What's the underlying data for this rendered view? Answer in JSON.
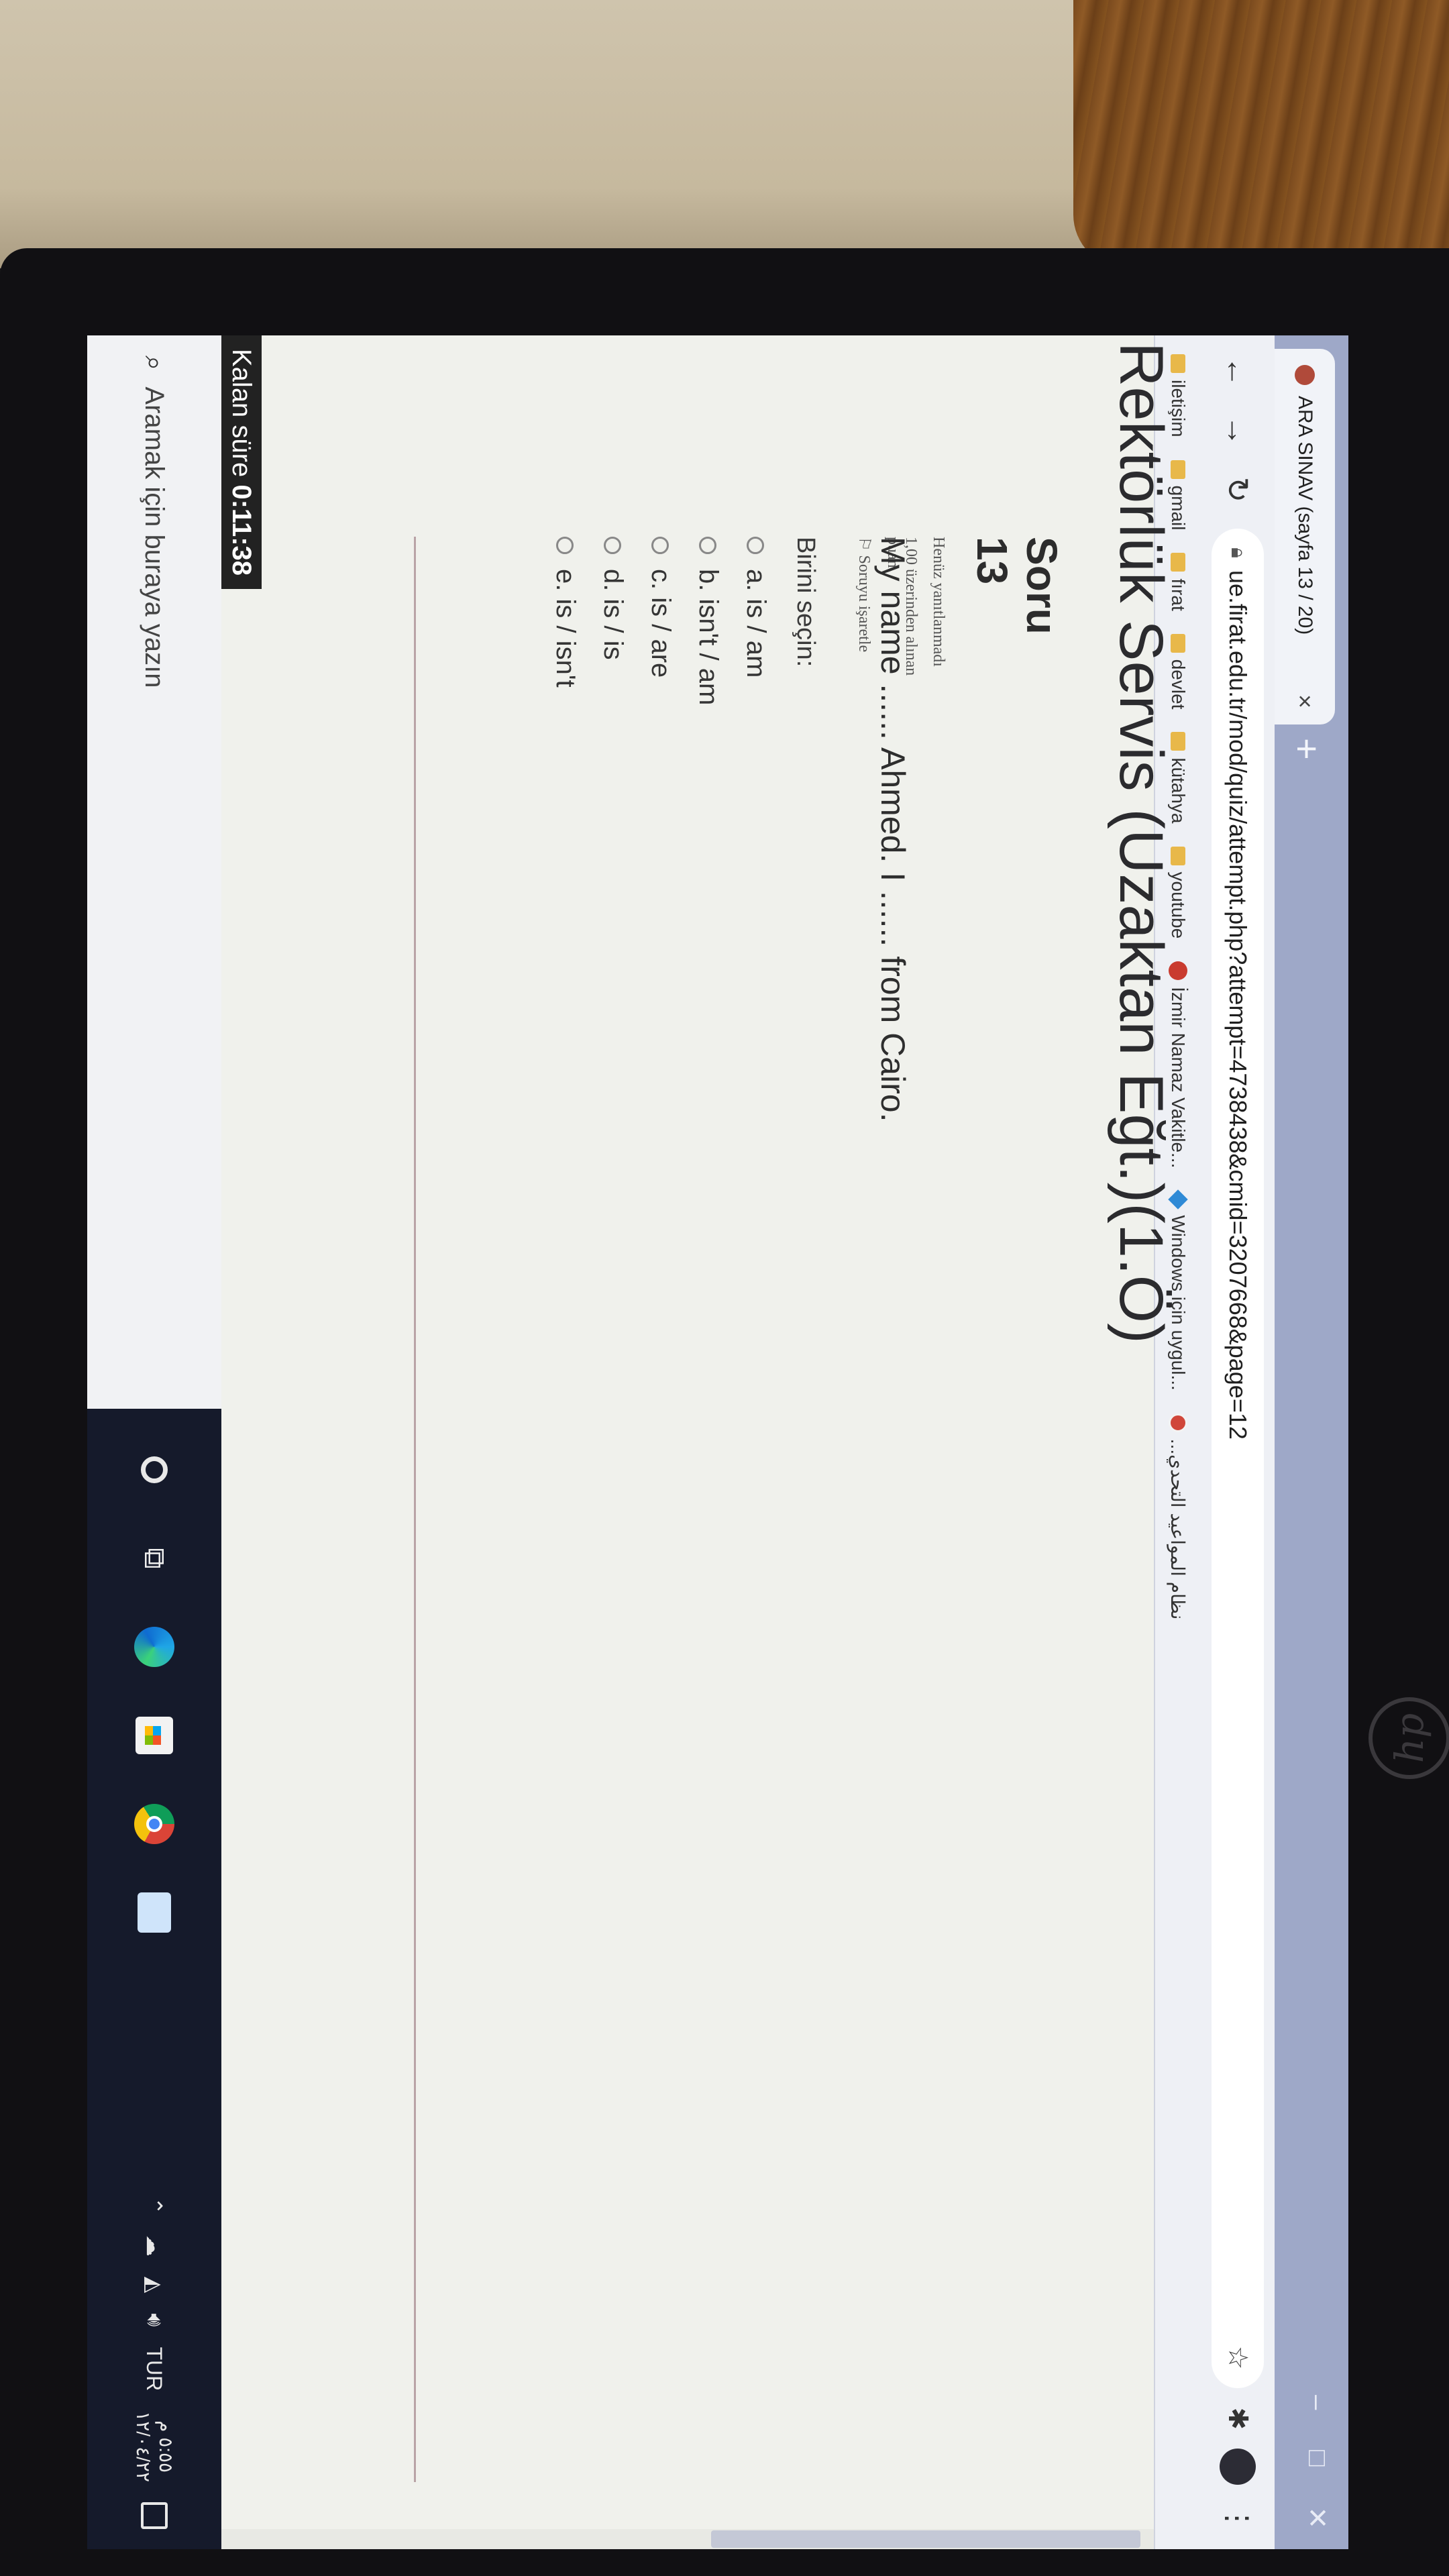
{
  "browser": {
    "tab_title": "ARA SINAV (sayfa 13 / 20)",
    "tab_close": "×",
    "new_tab": "+",
    "window_controls": [
      "–",
      "□",
      "✕"
    ],
    "url": "ue.firat.edu.tr/mod/quiz/attempt.php?attempt=4738438&cmid=3207668&page=12",
    "icons": [
      "back-arrow",
      "forward-arrow",
      "reload",
      "lock",
      "star",
      "extensions",
      "profile",
      "menu"
    ],
    "bookmarks": [
      {
        "label": "iletişim",
        "icon": "folder"
      },
      {
        "label": "gmail",
        "icon": "folder"
      },
      {
        "label": "fırat",
        "icon": "folder"
      },
      {
        "label": "devlet",
        "icon": "folder"
      },
      {
        "label": "kütahya",
        "icon": "folder"
      },
      {
        "label": "youtube",
        "icon": "folder"
      },
      {
        "label": "İzmir Namaz Vakitle...",
        "icon": "red-dot"
      },
      {
        "label": "Windows için uygul...",
        "icon": "windows"
      },
      {
        "label": "نظام المواعيد التحدي...",
        "icon": "globe"
      }
    ]
  },
  "page": {
    "site_header": "Rektörlük Servis (Uzaktan Eğt.)(1.Ö)",
    "question": {
      "number_label": "Soru 13",
      "state": "Henüz yanıtlanmadı",
      "grade": "1,00 üzerinden alınan puan",
      "flag": "Soruyu işaretle",
      "text": "My name ...... Ahmed. I ...... from Cairo.",
      "prompt": "Birini seçin:",
      "answers": [
        "a. is / am",
        "b. isn't / am",
        "c. is / are",
        "d. is / is",
        "e. is / isn't"
      ]
    },
    "timer_label": "Kalan süre",
    "timer_value": "0:11:38"
  },
  "taskbar": {
    "search_placeholder": "Aramak için buraya yazın",
    "language": "TUR",
    "time": "٥:٥٥ م",
    "date": "١٢/٠٤/٢٢"
  },
  "device": {
    "brand": "hp"
  }
}
